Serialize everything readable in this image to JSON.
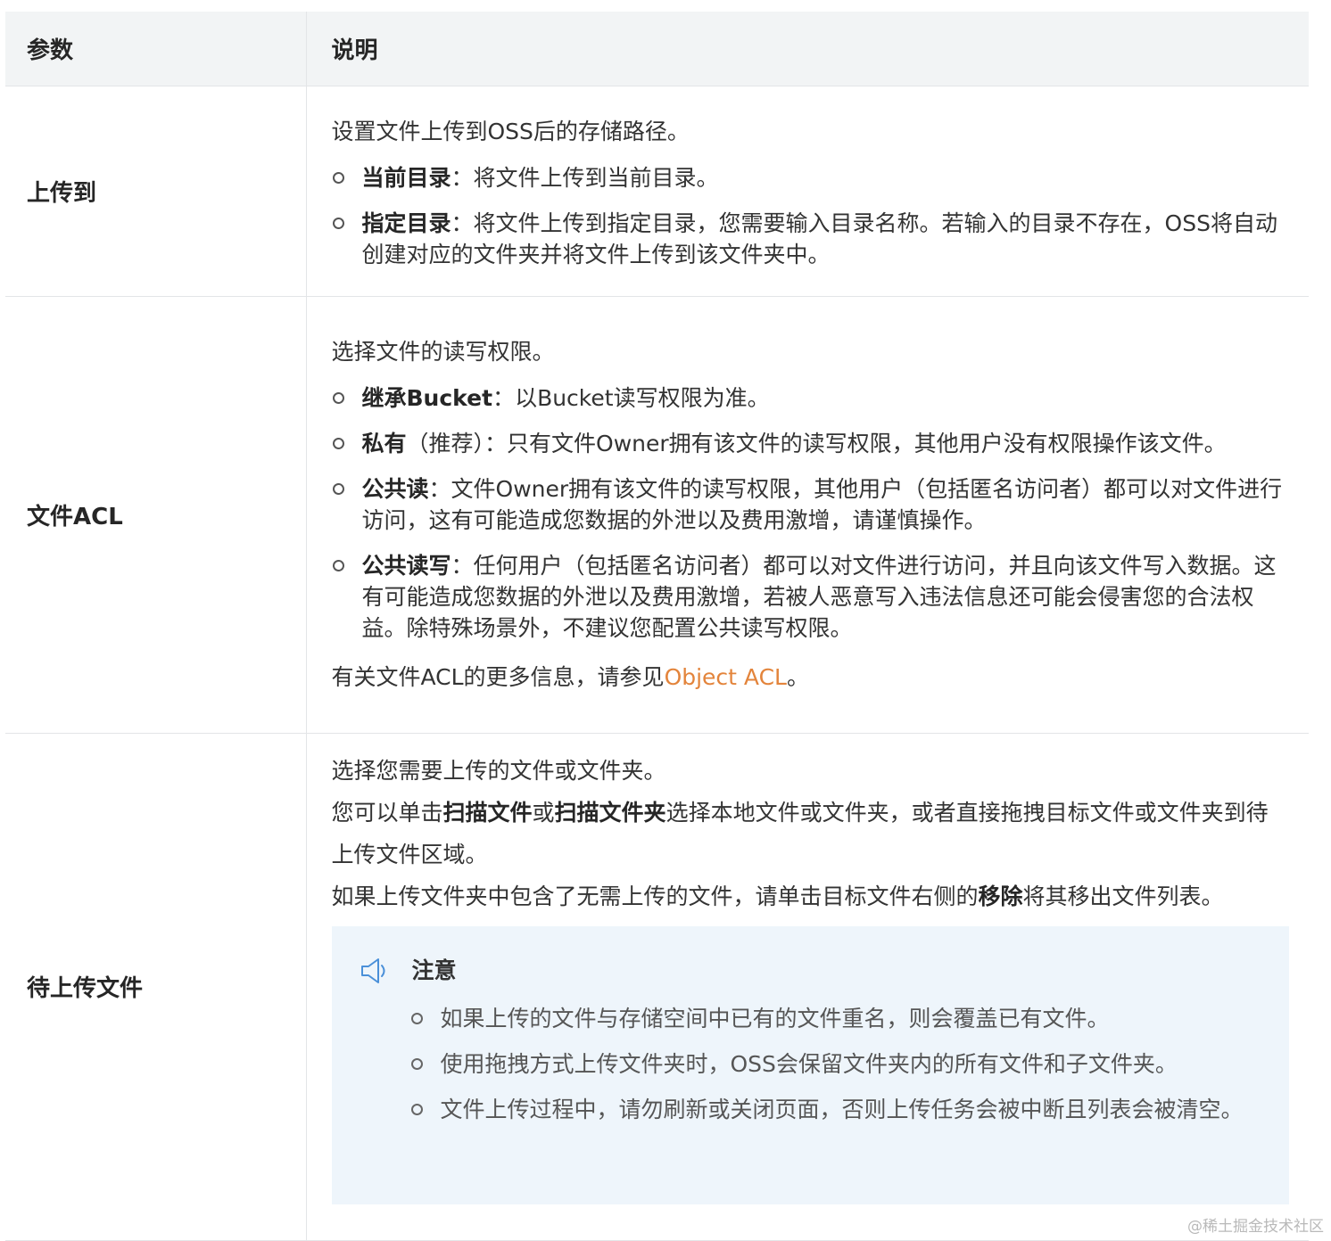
{
  "table": {
    "headers": {
      "param": "参数",
      "desc": "说明"
    },
    "upload_to": {
      "name": "上传到",
      "intro": "设置文件上传到OSS后的存储路径。",
      "options": [
        {
          "label": "当前目录",
          "sep": "：",
          "text": "将文件上传到当前目录。"
        },
        {
          "label": "指定目录",
          "sep": "：",
          "text": "将文件上传到指定目录，您需要输入目录名称。若输入的目录不存在，OSS将自动创建对应的文件夹并将文件上传到该文件夹中。"
        }
      ]
    },
    "file_acl": {
      "name": "文件ACL",
      "intro": "选择文件的读写权限。",
      "options": [
        {
          "label": "继承Bucket",
          "sep": "：",
          "text": "以Bucket读写权限为准。"
        },
        {
          "label": "私有",
          "sep": "（推荐）：",
          "text": "只有文件Owner拥有该文件的读写权限，其他用户没有权限操作该文件。"
        },
        {
          "label": "公共读",
          "sep": "：",
          "text": "文件Owner拥有该文件的读写权限，其他用户（包括匿名访问者）都可以对文件进行访问，这有可能造成您数据的外泄以及费用激增，请谨慎操作。"
        },
        {
          "label": "公共读写",
          "sep": "：",
          "text": "任何用户（包括匿名访问者）都可以对文件进行访问，并且向该文件写入数据。这有可能造成您数据的外泄以及费用激增，若被人恶意写入违法信息还可能会侵害您的合法权益。除特殊场景外，不建议您配置公共读写权限。"
        }
      ],
      "more_prefix": "有关文件ACL的更多信息，请参见",
      "more_link": "Object ACL",
      "more_suffix": "。"
    },
    "pending_files": {
      "name": "待上传文件",
      "line1": "选择您需要上传的文件或文件夹。",
      "line2_a": "您可以单击",
      "line2_b": "扫描文件",
      "line2_c": "或",
      "line2_d": "扫描文件夹",
      "line2_e": "选择本地文件或文件夹，或者直接拖拽目标文件或文件夹到待上传文件区域。",
      "line3_a": "如果上传文件夹中包含了无需上传的文件，请单击目标文件右侧的",
      "line3_b": "移除",
      "line3_c": "将其移出文件列表。",
      "note": {
        "icon": "speaker-icon",
        "title": "注意",
        "items": [
          "如果上传的文件与存储空间中已有的文件重名，则会覆盖已有文件。",
          "使用拖拽方式上传文件夹时，OSS会保留文件夹内的所有文件和子文件夹。",
          "文件上传过程中，请勿刷新或关闭页面，否则上传任务会被中断且列表会被清空。"
        ]
      }
    }
  },
  "watermark": "@稀土掘金技术社区",
  "colors": {
    "link": "#e3843b",
    "header_bg": "#f2f4f5",
    "note_bg": "#eef5fb"
  }
}
